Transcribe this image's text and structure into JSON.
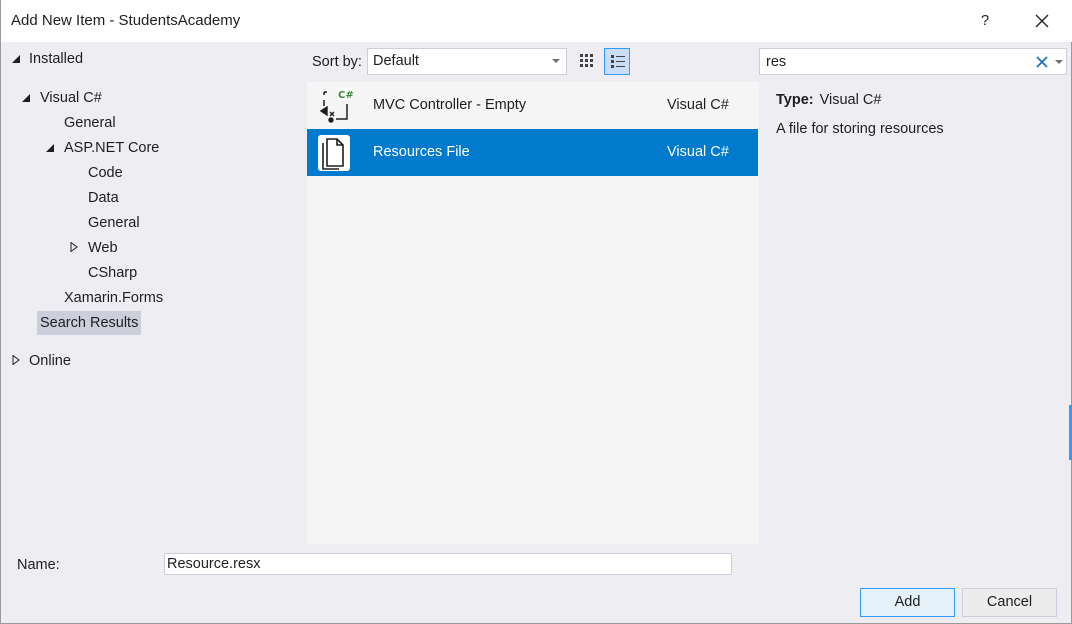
{
  "window": {
    "title": "Add New Item - StudentsAcademy",
    "help_label": "?"
  },
  "tree": {
    "items": [
      {
        "label": "Installed",
        "expanded": true
      },
      {
        "label": "Visual C#",
        "expanded": true
      },
      {
        "label": "General"
      },
      {
        "label": "ASP.NET Core",
        "expanded": true
      },
      {
        "label": "Code"
      },
      {
        "label": "Data"
      },
      {
        "label": "General"
      },
      {
        "label": "Web",
        "expanded": false
      },
      {
        "label": "CSharp"
      },
      {
        "label": "Xamarin.Forms"
      },
      {
        "label": "Search Results",
        "selected": true
      },
      {
        "label": "Online",
        "expanded": false
      }
    ]
  },
  "toolbar": {
    "sort_label": "Sort by:",
    "sort_value": "Default"
  },
  "search": {
    "value": "res"
  },
  "items": [
    {
      "name": "MVC Controller - Empty",
      "lang": "Visual C#",
      "icon": "csharp-controller-icon",
      "badge": "C#"
    },
    {
      "name": "Resources File",
      "lang": "Visual C#",
      "icon": "resource-file-icon",
      "selected": true
    }
  ],
  "details": {
    "type_label": "Type:",
    "type_value": "Visual C#",
    "description": "A file for storing resources"
  },
  "footer": {
    "name_label": "Name:",
    "name_value": "Resource.resx",
    "add_label": "Add",
    "cancel_label": "Cancel"
  },
  "colors": {
    "accent": "#007acc",
    "selection": "#cccedb",
    "background": "#eeeef2"
  }
}
